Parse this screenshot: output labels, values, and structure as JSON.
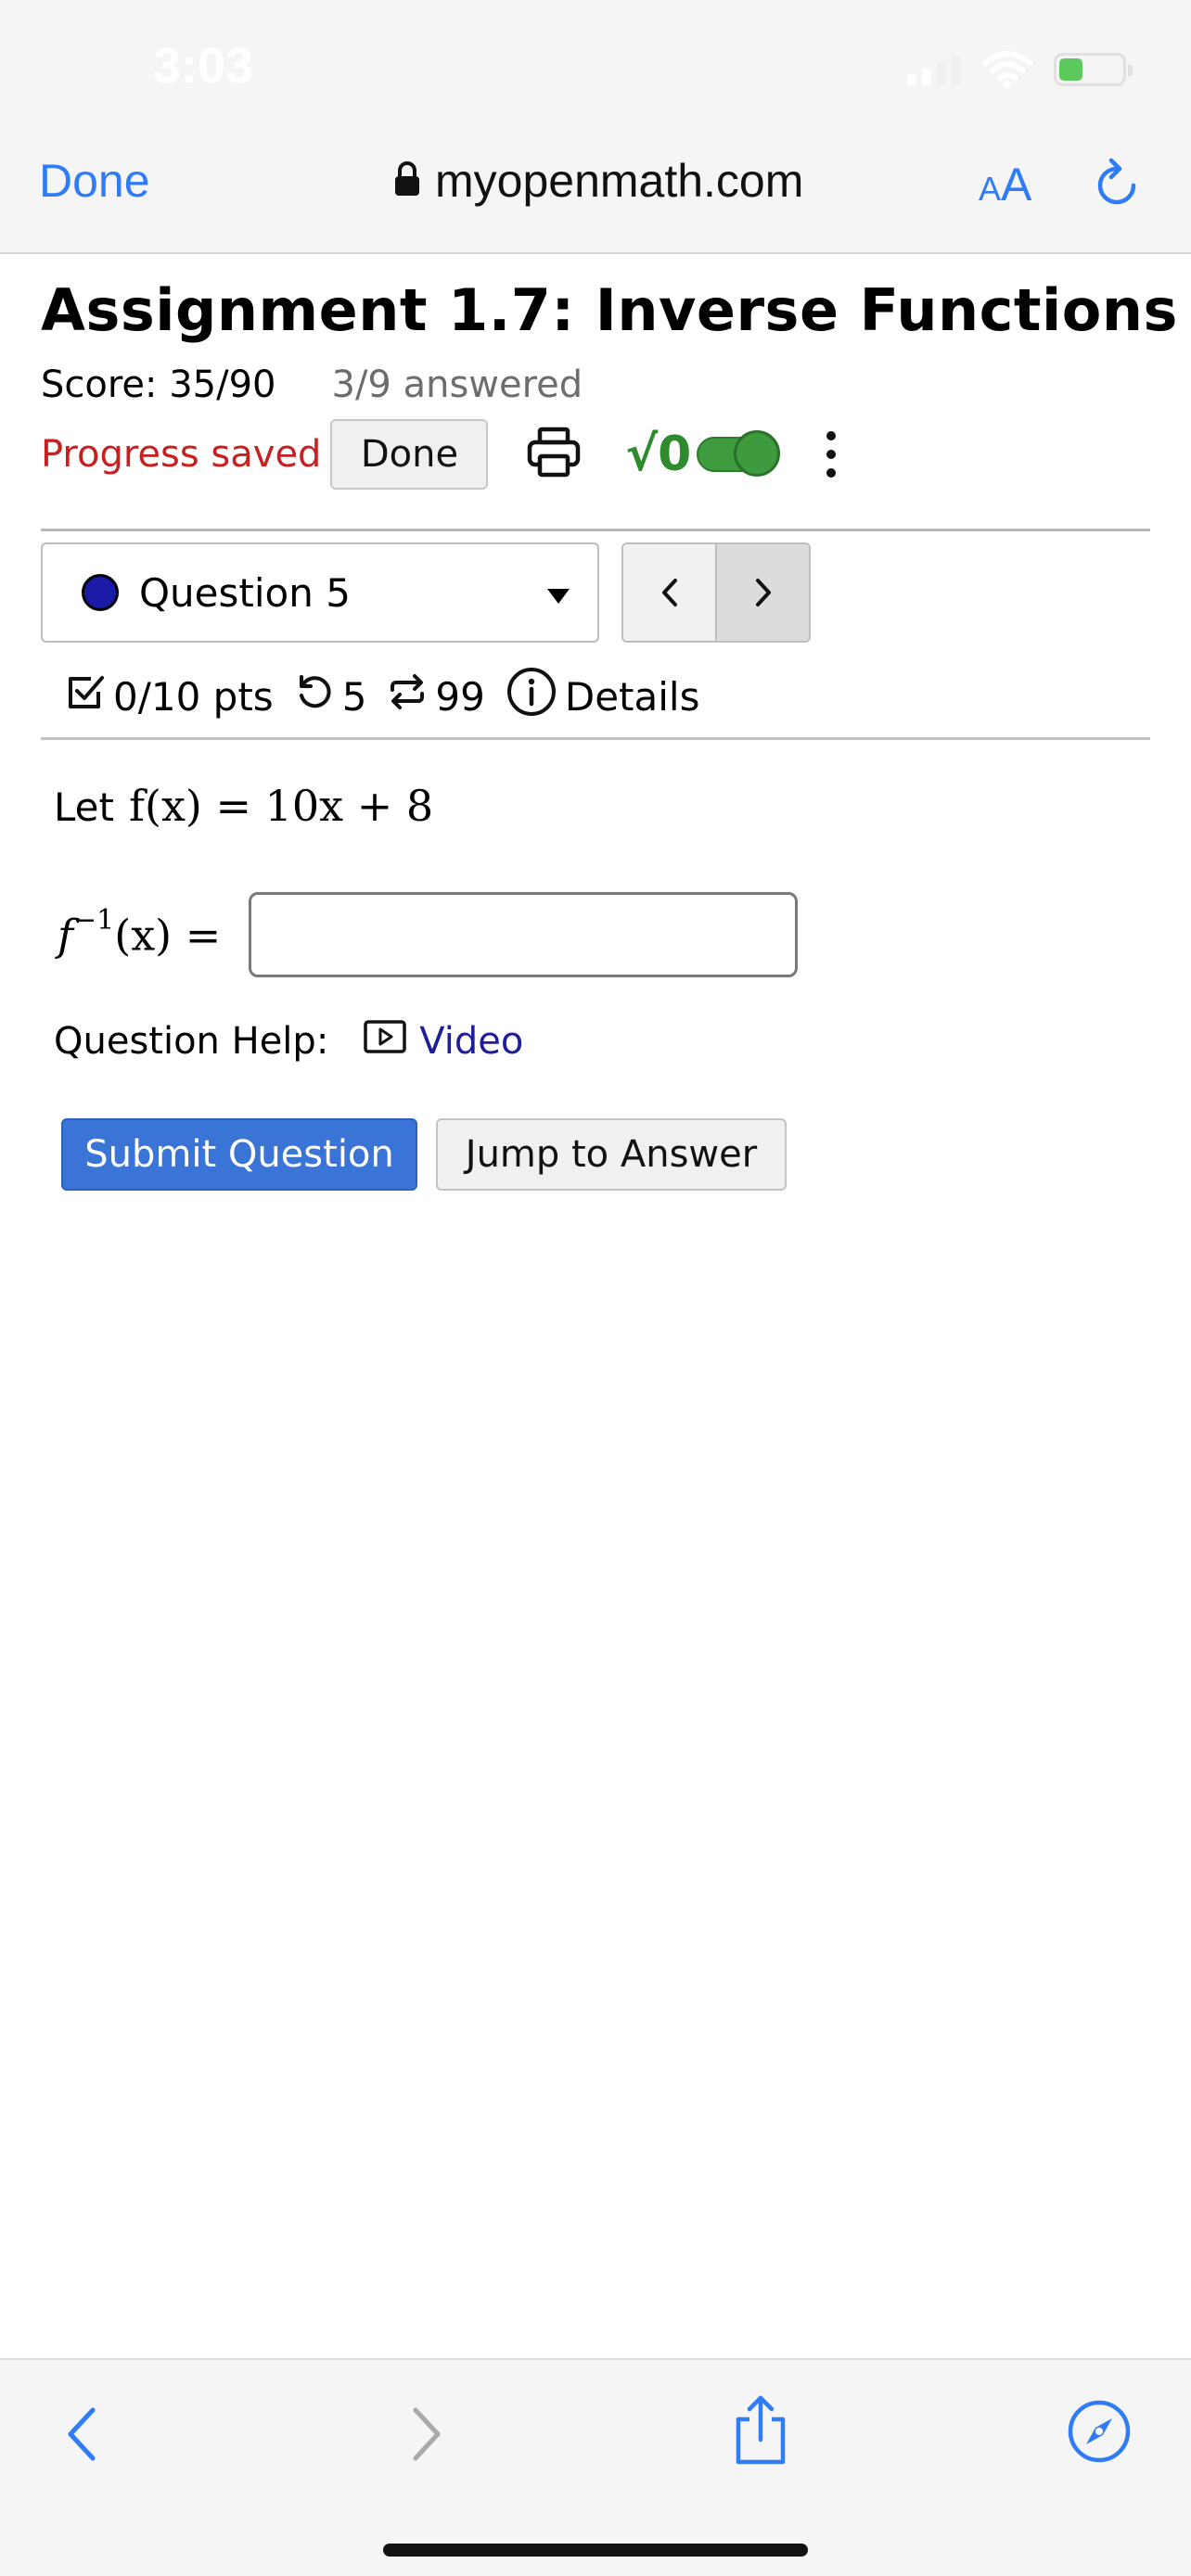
{
  "status_bar": {
    "time": "3:03"
  },
  "browser": {
    "done_label": "Done",
    "url": "myopenmath.com",
    "text_size_small": "A",
    "text_size_large": "A"
  },
  "assignment": {
    "title": "Assignment 1.7: Inverse Functions",
    "score": "Score: 35/90",
    "answered": "3/9 answered",
    "progress": "Progress saved",
    "done_label": "Done",
    "math_entry_symbol": "√0"
  },
  "question_nav": {
    "selected": "Question 5",
    "prev": "‹",
    "next": "›",
    "points": "0/10 pts",
    "attempts": "5",
    "versions": "99",
    "details": "Details"
  },
  "question": {
    "let_prefix": "Let",
    "function_def": "f(x) = 10x + 8",
    "inverse_lhs": "f",
    "inverse_sup": "−1",
    "inverse_rest": "(x) =",
    "answer_value": "",
    "help_label": "Question Help:",
    "video_label": "Video",
    "submit_label": "Submit Question",
    "jump_label": "Jump to Answer"
  },
  "colors": {
    "browser_blue": "#2f7cf6",
    "progress_red": "#c62020",
    "submit_blue": "#3974d6",
    "toggle_green": "#3e9b3e",
    "link_indigo": "#1e1e9c"
  },
  "icons": {
    "lock": "lock-icon",
    "reload": "reload-icon",
    "printer": "printer-icon",
    "checkbox": "checkbox-icon",
    "attempts": "retry-icon",
    "versions": "regenerate-icon",
    "info": "info-icon",
    "video": "video-icon",
    "back": "chevron-left-icon",
    "forward": "chevron-right-icon",
    "share": "share-icon",
    "compass": "compass-icon"
  }
}
